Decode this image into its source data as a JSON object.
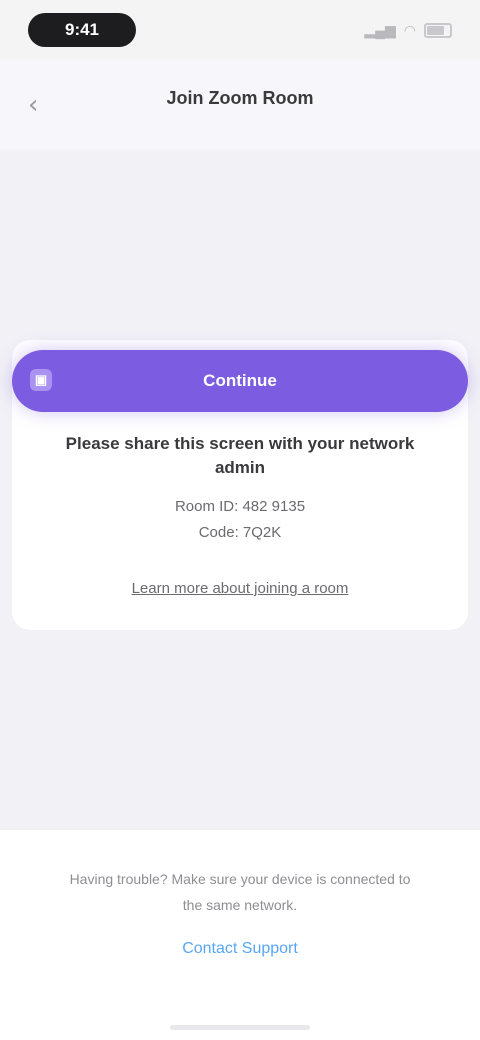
{
  "status_bar": {
    "time": "9:41"
  },
  "nav": {
    "back_label": "‹",
    "title": "Join Zoom Room"
  },
  "card": {
    "button_label": "Continue",
    "headline": "Please share this screen with your network admin",
    "subtext_line1": "Room ID: 482 9135",
    "subtext_line2": "Code: 7Q2K",
    "link_label": "Learn more about joining a room"
  },
  "footer": {
    "text": "Having trouble? Make sure your device is connected to the same network.",
    "link_label": "Contact Support"
  },
  "colors": {
    "accent": "#7c5ce0",
    "link": "#58a6f5",
    "background": "#f2f1f6"
  }
}
